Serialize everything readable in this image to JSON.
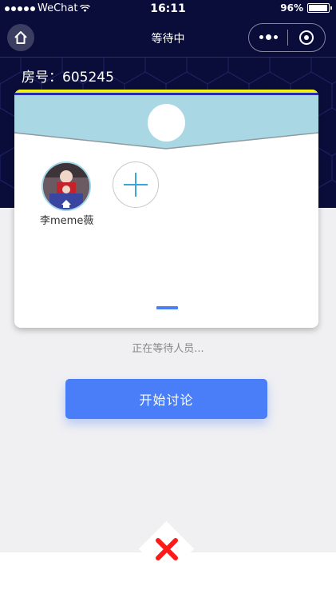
{
  "status_bar": {
    "carrier": "WeChat",
    "time": "16:11",
    "battery_percent": "96%",
    "battery_level": 0.96
  },
  "nav": {
    "title": "等待中",
    "home_icon": "home-icon",
    "more_icon": "more-dots-icon",
    "close_icon": "target-circle-icon"
  },
  "room": {
    "label": "房号：605245"
  },
  "members": [
    {
      "name": "李meme薇"
    }
  ],
  "add_member_icon": "plus-icon",
  "waiting_text": "正在等待人员...",
  "start_button_label": "开始讨论",
  "close_icon": "red-x-icon",
  "colors": {
    "header_bg": "#0a0d3a",
    "card_header": "#a9d8e4",
    "accent_blue": "#4a7ef9",
    "yellow_stripe": "#f0f21a",
    "close_red": "#ff1a1a"
  }
}
